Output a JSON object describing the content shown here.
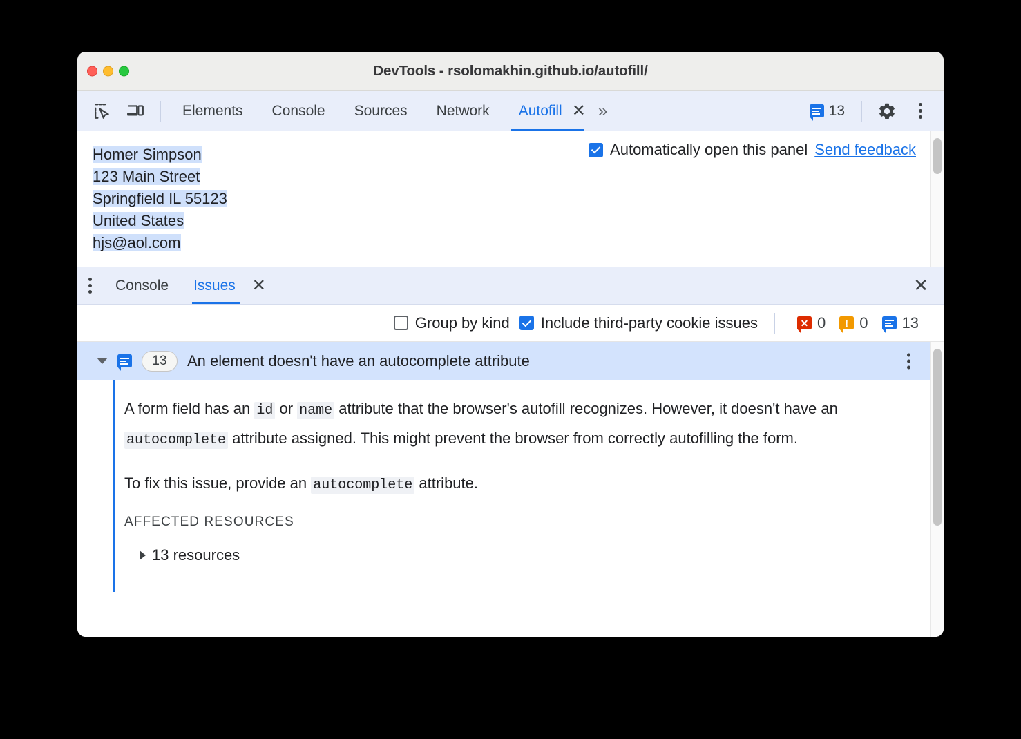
{
  "window": {
    "title": "DevTools - rsolomakhin.github.io/autofill/",
    "traffic_lights": [
      "close",
      "minimize",
      "maximize"
    ]
  },
  "toolbar": {
    "inspect_icon": "inspect-element-icon",
    "device_icon": "device-toolbar-icon",
    "tabs": [
      {
        "label": "Elements",
        "active": false
      },
      {
        "label": "Console",
        "active": false
      },
      {
        "label": "Sources",
        "active": false
      },
      {
        "label": "Network",
        "active": false
      },
      {
        "label": "Autofill",
        "active": true
      }
    ],
    "close_tab_label": "✕",
    "more_tabs_label": "»",
    "issues_count": "13",
    "settings_icon": "gear-icon",
    "more_icon": "kebab-menu-icon"
  },
  "autofill": {
    "address_lines": [
      "Homer Simpson",
      "123 Main Street",
      "Springfield IL 55123",
      "United States",
      "hjs@aol.com"
    ],
    "auto_open_checkbox": {
      "label": "Automatically open this panel",
      "checked": true
    },
    "feedback_link": "Send feedback"
  },
  "drawer": {
    "kebab_icon": "drawer-menu-icon",
    "tabs": [
      {
        "label": "Console",
        "active": false
      },
      {
        "label": "Issues",
        "active": true
      }
    ],
    "tab_close_label": "✕",
    "close_label": "✕"
  },
  "issues_toolbar": {
    "group_by_kind": {
      "label": "Group by kind",
      "checked": false
    },
    "third_party": {
      "label": "Include third-party cookie issues",
      "checked": true
    },
    "counts": {
      "errors": "0",
      "warnings": "0",
      "info": "13"
    }
  },
  "issue": {
    "expanded": true,
    "count_badge": "13",
    "title": "An element doesn't have an autocomplete attribute",
    "kebab_icon": "issue-menu-icon",
    "paragraph1": {
      "t1": "A form field has an ",
      "code1": "id",
      "t2": " or ",
      "code2": "name",
      "t3": " attribute that the browser's autofill recognizes. However, it doesn't have an ",
      "code3": "autocomplete",
      "t4": " attribute assigned. This might prevent the browser from correctly autofilling the form."
    },
    "paragraph2": {
      "t1": "To fix this issue, provide an ",
      "code1": "autocomplete",
      "t2": " attribute."
    },
    "affected_resources_label": "AFFECTED RESOURCES",
    "resources_label": "13 resources"
  },
  "colors": {
    "accent": "#1a73e8",
    "tabbar_bg": "#e9eefa",
    "selected_row": "#d3e3fd",
    "error": "#dd2c00",
    "warning": "#f29900"
  }
}
